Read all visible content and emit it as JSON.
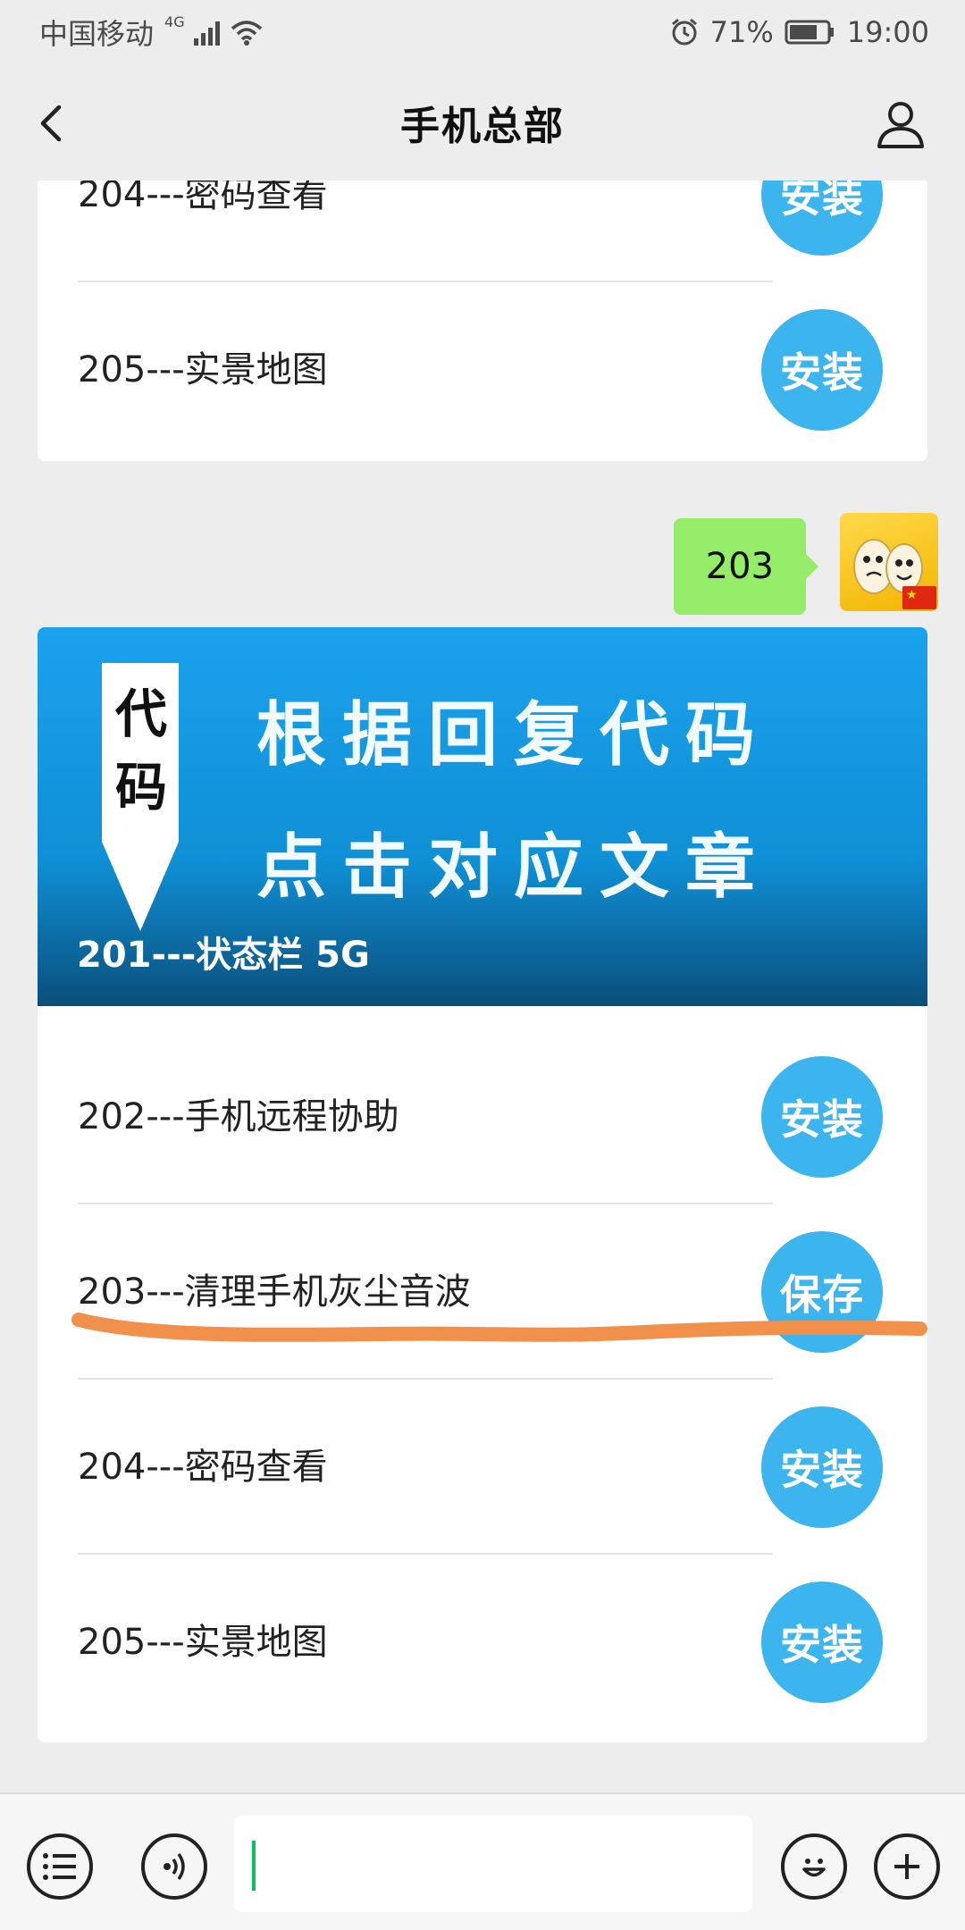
{
  "status_bar": {
    "carrier": "中国移动",
    "network": "4G",
    "battery": "71%",
    "time": "19:00"
  },
  "header": {
    "title": "手机总部"
  },
  "top_card": {
    "items": [
      {
        "label": "204---密码查看",
        "button": "安装"
      },
      {
        "label": "205---实景地图",
        "button": "安装"
      }
    ]
  },
  "message": {
    "text": "203"
  },
  "banner": {
    "tag_line1": "代",
    "tag_line2": "码",
    "line1": "根据回复代码",
    "line2": "点击对应文章",
    "caption": "201---状态栏 5G"
  },
  "main_card": {
    "items": [
      {
        "label": "202---手机远程协助",
        "button": "安装"
      },
      {
        "label": "203---清理手机灰尘音波",
        "button": "保存"
      },
      {
        "label": "204---密码查看",
        "button": "安装"
      },
      {
        "label": "205---实景地图",
        "button": "安装"
      }
    ]
  },
  "colors": {
    "background": "#ededed",
    "button_blue": "#3cb4ee",
    "bubble_green": "#95ec69",
    "annotation_orange": "#f0904a"
  },
  "icons": [
    "back-icon",
    "profile-icon",
    "menu-list-icon",
    "voice-icon",
    "emoji-icon",
    "plus-icon"
  ]
}
